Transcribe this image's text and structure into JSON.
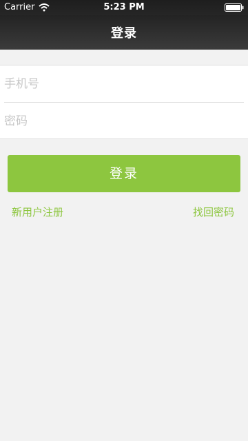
{
  "status_bar": {
    "carrier": "Carrier",
    "time": "5:23 PM",
    "wifi_icon": "wifi-icon",
    "battery_icon": "battery-icon"
  },
  "nav": {
    "title": "登录"
  },
  "form": {
    "phone_placeholder": "手机号",
    "password_placeholder": "密码"
  },
  "actions": {
    "login_label": "登录",
    "register_label": "新用户注册",
    "forgot_label": "找回密码"
  },
  "colors": {
    "accent": "#8dc63f",
    "background": "#f2f2f2",
    "navbar": "#2a2a2a"
  }
}
